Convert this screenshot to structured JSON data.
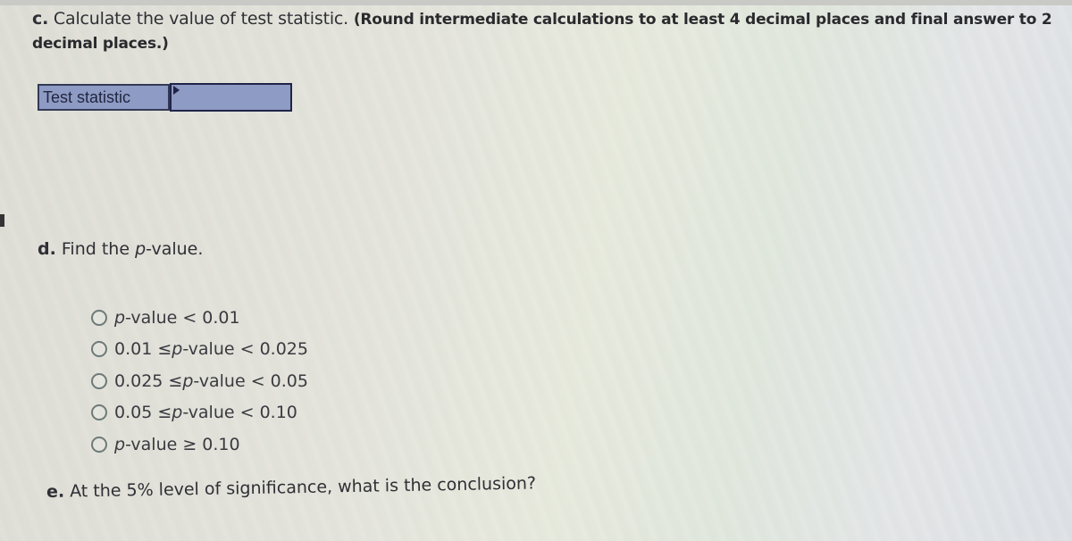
{
  "part_c": {
    "letter": "c.",
    "question": " Calculate the value of test statistic. ",
    "instruction": "(Round intermediate calculations to at least 4 decimal places and final answer to 2 decimal places.)",
    "answer_table": {
      "label": "Test statistic",
      "value": ""
    }
  },
  "part_d": {
    "letter": "d.",
    "question_prefix": " Find the ",
    "question_italic": "p",
    "question_suffix": "-value.",
    "options": [
      {
        "prefix": "",
        "italic": "p",
        "suffix": "-value < 0.01",
        "selected": false
      },
      {
        "prefix": "0.01 ≤ ",
        "italic": "p",
        "suffix": "-value < 0.025",
        "selected": false
      },
      {
        "prefix": "0.025 ≤ ",
        "italic": "p",
        "suffix": "-value < 0.05",
        "selected": false
      },
      {
        "prefix": "0.05 ≤ ",
        "italic": "p",
        "suffix": "-value < 0.10",
        "selected": false
      },
      {
        "prefix": "",
        "italic": "p",
        "suffix": "-value ≥ 0.10",
        "selected": false
      }
    ]
  },
  "part_e": {
    "letter": "e.",
    "question": " At the 5% level of significance, what is the conclusion?"
  }
}
